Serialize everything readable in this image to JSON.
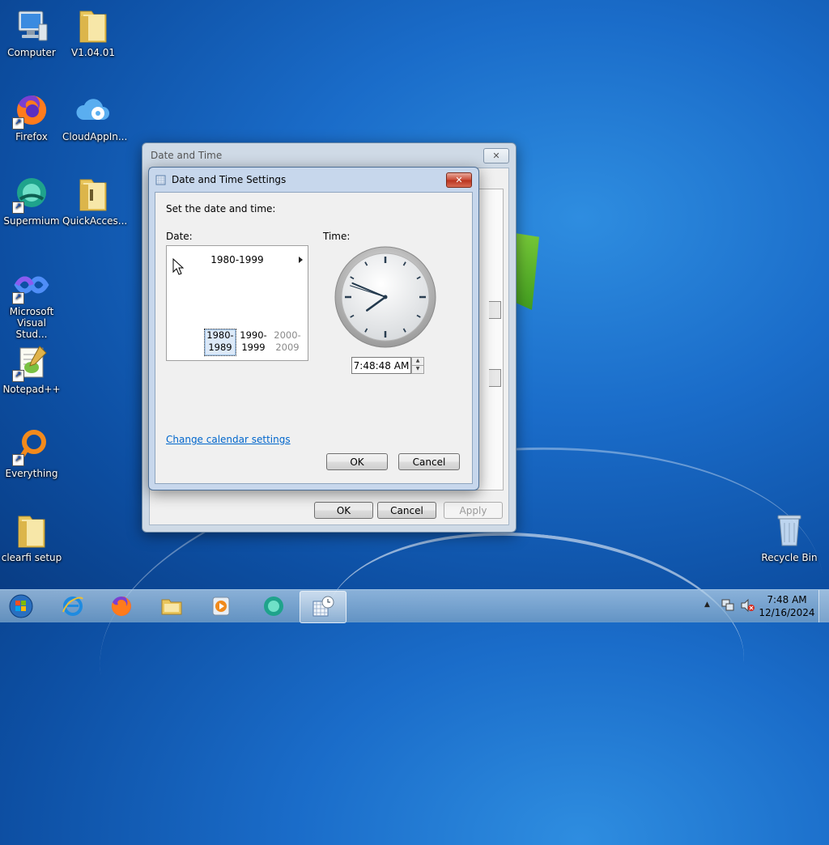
{
  "desktop": {
    "icons": [
      {
        "label": "Computer"
      },
      {
        "label": "V1.04.01"
      },
      {
        "label": "Firefox"
      },
      {
        "label": "CloudAppIn..."
      },
      {
        "label": "Supermium"
      },
      {
        "label": "QuickAcces..."
      },
      {
        "label": "Microsoft Visual Stud..."
      },
      {
        "label": "Notepad++"
      },
      {
        "label": "Everything"
      },
      {
        "label": "clearfi setup"
      },
      {
        "label": "Recycle Bin"
      }
    ]
  },
  "outer_window": {
    "title": "Date and Time",
    "ok_label": "OK",
    "cancel_label": "Cancel",
    "apply_label": "Apply"
  },
  "dialog": {
    "title": "Date and Time Settings",
    "instruction": "Set the date and time:",
    "date_label": "Date:",
    "time_label": "Time:",
    "calendar": {
      "header": "1980-1999",
      "decades": [
        {
          "line1": "1980-",
          "line2": "1989",
          "selected": true
        },
        {
          "line1": "1990-",
          "line2": "1999",
          "selected": false
        },
        {
          "line1": "2000-",
          "line2": "2009",
          "selected": false,
          "dim": true
        }
      ]
    },
    "clock": {
      "hour": 7,
      "minute": 48,
      "second": 48
    },
    "time_value": "7:48:48 AM",
    "change_calendar_link": "Change calendar settings",
    "ok_label": "OK",
    "cancel_label": "Cancel"
  },
  "taskbar": {
    "items": [
      {
        "icon": "start-orb-icon"
      },
      {
        "icon": "internet-explorer-icon"
      },
      {
        "icon": "firefox-icon"
      },
      {
        "icon": "file-explorer-icon"
      },
      {
        "icon": "media-player-icon"
      },
      {
        "icon": "supermium-icon"
      },
      {
        "icon": "date-time-settings-icon",
        "active": true
      }
    ],
    "clock_time": "7:48 AM",
    "clock_date": "12/16/2024"
  },
  "colors": {
    "desktop_blue": "#1a6cc9",
    "link_blue": "#0066cc",
    "close_red": "#c94a35"
  }
}
